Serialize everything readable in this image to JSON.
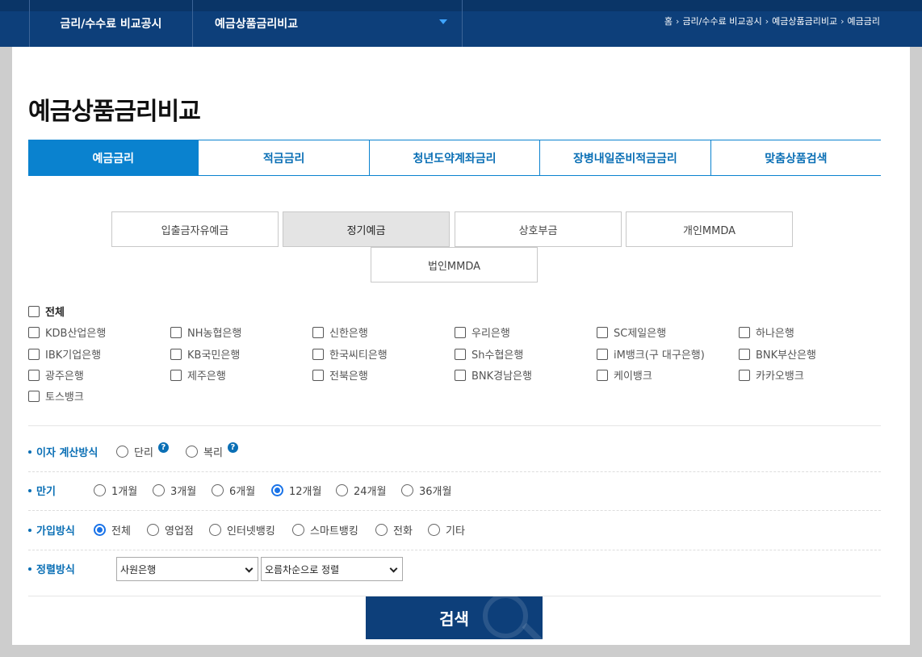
{
  "header": {
    "nav_main": "금리/수수료 비교공시",
    "nav_sub": "예금상품금리비교",
    "breadcrumb": [
      "홈",
      "금리/수수료 비교공시",
      "예금상품금리비교",
      "예금금리"
    ]
  },
  "page_title": "예금상품금리비교",
  "tabs": [
    {
      "label": "예금금리",
      "active": true
    },
    {
      "label": "적금금리",
      "active": false
    },
    {
      "label": "청년도약계좌금리",
      "active": false
    },
    {
      "label": "장병내일준비적금금리",
      "active": false
    },
    {
      "label": "맞춤상품검색",
      "active": false
    }
  ],
  "subtabs": [
    {
      "label": "입출금자유예금",
      "active": false
    },
    {
      "label": "정기예금",
      "active": true
    },
    {
      "label": "상호부금",
      "active": false
    },
    {
      "label": "개인MMDA",
      "active": false
    },
    {
      "label": "법인MMDA",
      "active": false
    }
  ],
  "banks": {
    "all_label": "전체",
    "items": [
      "KDB산업은행",
      "NH농협은행",
      "신한은행",
      "우리은행",
      "SC제일은행",
      "하나은행",
      "IBK기업은행",
      "KB국민은행",
      "한국씨티은행",
      "Sh수협은행",
      "iM뱅크(구 대구은행)",
      "BNK부산은행",
      "광주은행",
      "제주은행",
      "전북은행",
      "BNK경남은행",
      "케이뱅크",
      "카카오뱅크",
      "토스뱅크"
    ]
  },
  "interest_calc": {
    "label": "이자 계산방식",
    "options": [
      "단리",
      "복리"
    ],
    "help_icon": "?"
  },
  "term": {
    "label": "만기",
    "options": [
      "1개월",
      "3개월",
      "6개월",
      "12개월",
      "24개월",
      "36개월"
    ],
    "selected": "12개월"
  },
  "join_method": {
    "label": "가입방식",
    "options": [
      "전체",
      "영업점",
      "인터넷뱅킹",
      "스마트뱅킹",
      "전화",
      "기타"
    ],
    "selected": "전체"
  },
  "sort": {
    "label": "정렬방식",
    "select1": "사원은행",
    "select2": "오름차순으로 정렬"
  },
  "search_button": "검색",
  "colors": {
    "header_bg": "#0d3f7a",
    "accent": "#0a82cf",
    "label_blue": "#0a6fb5",
    "radio_on": "#1a73e8"
  }
}
